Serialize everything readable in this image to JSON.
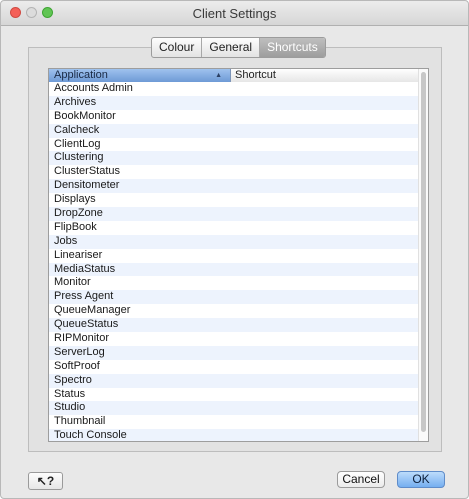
{
  "window": {
    "title": "Client Settings",
    "controls": [
      "close-icon",
      "minimize-icon",
      "zoom-icon"
    ]
  },
  "tabs": [
    {
      "label": "Colour",
      "active": false
    },
    {
      "label": "General",
      "active": false
    },
    {
      "label": "Shortcuts",
      "active": true
    }
  ],
  "table": {
    "columns": {
      "application": "Application",
      "shortcut": "Shortcut",
      "sort_indicator": "▲"
    },
    "rows": [
      "Accounts Admin",
      "Archives",
      "BookMonitor",
      "Calcheck",
      "ClientLog",
      "Clustering",
      "ClusterStatus",
      "Densitometer",
      "Displays",
      "DropZone",
      "FlipBook",
      "Jobs",
      "Lineariser",
      "MediaStatus",
      "Monitor",
      "Press Agent",
      "QueueManager",
      "QueueStatus",
      "RIPMonitor",
      "ServerLog",
      "SoftProof",
      "Spectro",
      "Status",
      "Studio",
      "Thumbnail",
      "Touch Console"
    ]
  },
  "footer": {
    "help_label": "↖?",
    "cancel_label": "Cancel",
    "ok_label": "OK"
  },
  "colors": {
    "selected_tab": "#a9a9a9",
    "header_highlight": "#7aa4dc",
    "alt_row": "#edf3fd",
    "ok_button": "#8fbdf3"
  }
}
